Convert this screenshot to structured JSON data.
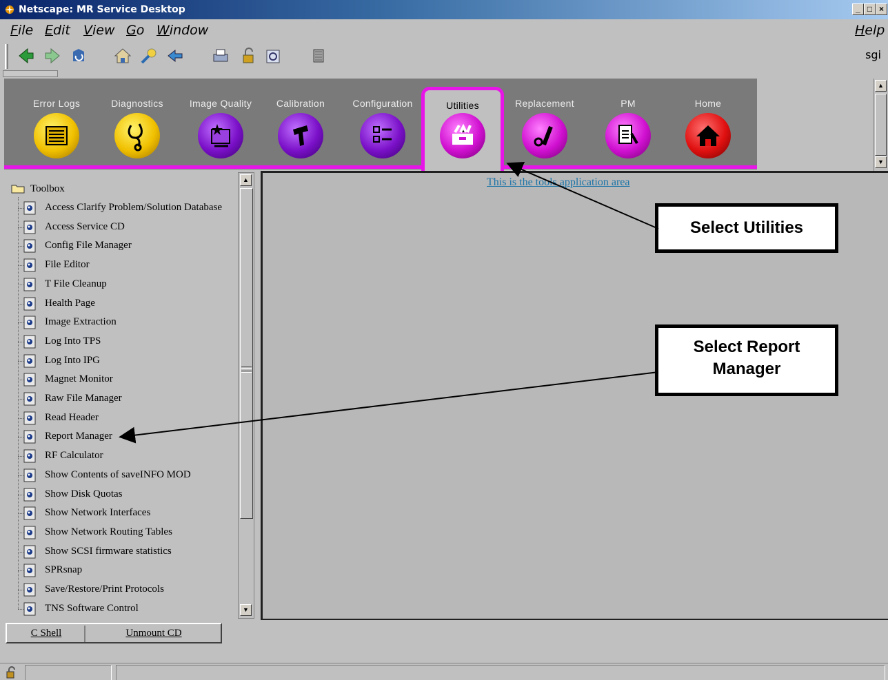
{
  "window": {
    "title": "Netscape: MR Service Desktop",
    "controls": [
      "_",
      "□",
      "×"
    ]
  },
  "menubar": {
    "items": [
      {
        "ul": "F",
        "rest": "ile"
      },
      {
        "ul": "E",
        "rest": "dit"
      },
      {
        "ul": "V",
        "rest": "iew"
      },
      {
        "ul": "G",
        "rest": "o"
      },
      {
        "ul": "W",
        "rest": "indow"
      }
    ],
    "help": {
      "ul": "H",
      "rest": "elp"
    }
  },
  "toolbar": {
    "icons": [
      "back-icon",
      "forward-icon",
      "reload-icon",
      "home-icon",
      "search-icon",
      "guide-icon",
      "print-icon",
      "security-icon",
      "shop-icon",
      "stop-icon"
    ],
    "brand": "sgi"
  },
  "nav": {
    "tabs": [
      {
        "label": "Error Logs",
        "icon": "error-logs-icon",
        "color": "#f0c000"
      },
      {
        "label": "Diagnostics",
        "icon": "diagnostics-icon",
        "color": "#f0c000"
      },
      {
        "label": "Image Quality",
        "icon": "image-quality-icon",
        "color": "#7a10c8"
      },
      {
        "label": "Calibration",
        "icon": "calibration-icon",
        "color": "#7a10c8"
      },
      {
        "label": "Configuration",
        "icon": "configuration-icon",
        "color": "#7a10c8"
      },
      {
        "label": "Utilities",
        "icon": "utilities-icon",
        "color": "#d010d0"
      },
      {
        "label": "Replacement",
        "icon": "replacement-icon",
        "color": "#d010d0"
      },
      {
        "label": "PM",
        "icon": "pm-icon",
        "color": "#d010d0"
      },
      {
        "label": "Home",
        "icon": "home-icon",
        "color": "#e01010"
      }
    ],
    "active": "Utilities",
    "accent": "#e815e8"
  },
  "toolbox": {
    "title": "Toolbox",
    "items": [
      "Access Clarify Problem/Solution Database",
      "Access Service CD",
      "Config File Manager",
      "File Editor",
      "T File Cleanup",
      "Health Page",
      "Image Extraction",
      "Log Into TPS",
      "Log Into IPG",
      "Magnet Monitor",
      "Raw File Manager",
      "Read Header",
      "Report Manager",
      "RF Calculator",
      "Show Contents of saveINFO MOD",
      "Show Disk Quotas",
      "Show Network Interfaces",
      "Show Network Routing Tables",
      "Show SCSI firmware statistics",
      "SPRsnap",
      "Save/Restore/Print Protocols",
      "TNS Software Control"
    ]
  },
  "buttons": {
    "cshell": "C Shell",
    "unmount": "Unmount CD"
  },
  "app_area": {
    "link_text": "This is the tools application area "
  },
  "callouts": {
    "utilities": "Select Utilities",
    "report_manager_line1": "Select Report",
    "report_manager_line2": "Manager"
  }
}
